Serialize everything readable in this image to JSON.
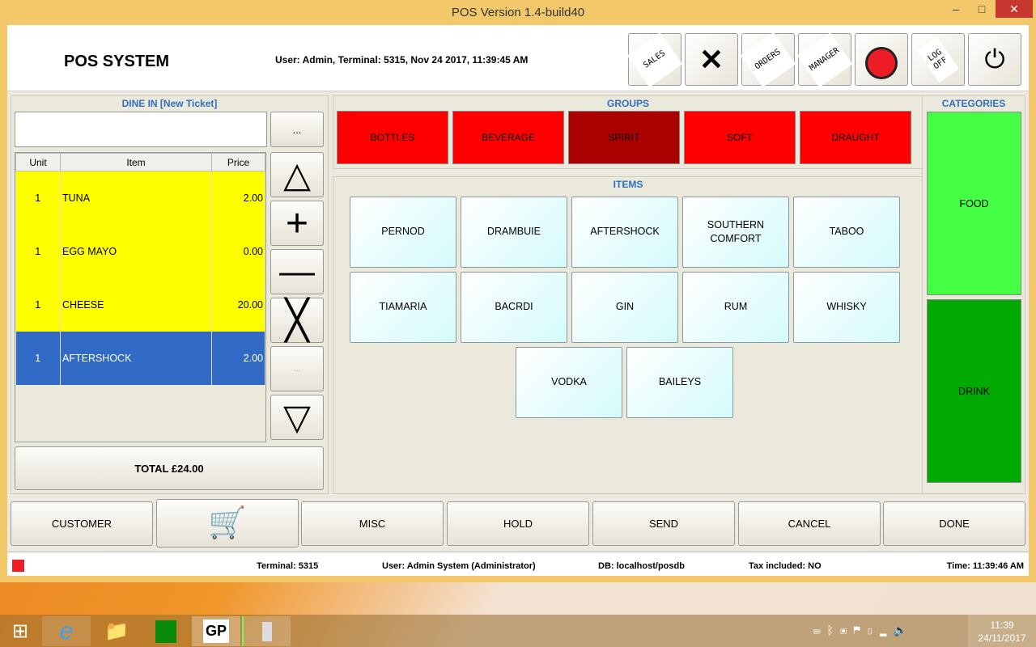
{
  "window": {
    "title": "POS Version 1.4-build40",
    "minimize": "‒",
    "maximize": "□",
    "close": "✕"
  },
  "header": {
    "logo": "POS SYSTEM",
    "user_info": "User: Admin, Terminal: 5315, Nov 24 2017, 11:39:45 AM",
    "toolbar": [
      {
        "label": "SALES"
      },
      {
        "label": "tools"
      },
      {
        "label": "ORDERS"
      },
      {
        "label": "MANAGER"
      },
      {
        "label": "timer"
      },
      {
        "label": "LOG OFF"
      },
      {
        "label": "power"
      }
    ]
  },
  "ticket": {
    "title": "DINE IN [New Ticket]",
    "search_value": "",
    "more_label": "...",
    "columns": [
      "Unit",
      "Item",
      "Price"
    ],
    "rows": [
      {
        "unit": "1",
        "item": "TUNA",
        "price": "2.00"
      },
      {
        "unit": "1",
        "item": "EGG MAYO",
        "price": "0.00"
      },
      {
        "unit": "1",
        "item": "CHEESE",
        "price": "20.00"
      },
      {
        "unit": "1",
        "item": "AFTERSHOCK",
        "price": "2.00",
        "selected": true
      }
    ],
    "side_disabled": "...",
    "total": "TOTAL £24.00"
  },
  "groups": {
    "title": "GROUPS",
    "items": [
      "BOTTLES",
      "BEVERAGE",
      "SPIRIT",
      "SOFT",
      "DRAUGHT"
    ],
    "selected": "SPIRIT"
  },
  "items": {
    "title": "ITEMS",
    "list": [
      "PERNOD",
      "DRAMBUIE",
      "AFTERSHOCK",
      "SOUTHERN COMFORT",
      "TABOO",
      "TIAMARIA",
      "BACRDI",
      "GIN",
      "RUM",
      "WHISKY",
      "VODKA",
      "BAILEYS"
    ]
  },
  "categories": {
    "title": "CATEGORIES",
    "items": [
      "FOOD",
      "DRINK"
    ]
  },
  "bottom": {
    "customer": "CUSTOMER",
    "misc": "MISC",
    "hold": "HOLD",
    "send": "SEND",
    "cancel": "CANCEL",
    "done": "DONE"
  },
  "status": {
    "terminal": "Terminal: 5315",
    "user": "User: Admin System (Administrator)",
    "db": "DB: localhost/posdb",
    "tax": "Tax included: NO",
    "time": "Time: 11:39:46 AM"
  },
  "taskbar": {
    "gp": "GP",
    "clock_time": "11:39",
    "clock_date": "24/11/2017"
  },
  "colors": {
    "group_red": "#ff0000",
    "group_selected": "#aa0000",
    "row_yellow": "#ffff00",
    "row_selected": "#316ac5",
    "food": "#44ff44",
    "drink": "#00aa00",
    "accent": "#2f6fc0"
  }
}
